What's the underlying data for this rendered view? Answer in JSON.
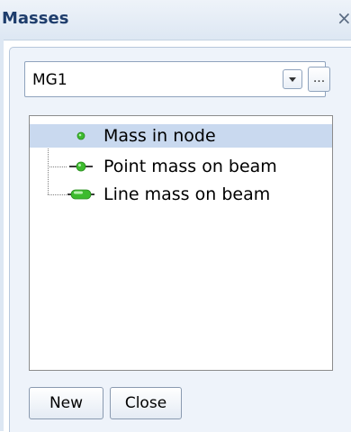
{
  "window": {
    "title": "Masses",
    "close_glyph": "×"
  },
  "combo": {
    "selected_value": "MG1",
    "more_button_label": "..."
  },
  "tree": {
    "items": [
      {
        "label": "Mass in node",
        "icon": "mass-in-node-icon",
        "selected": true
      },
      {
        "label": "Point mass on beam",
        "icon": "point-mass-on-beam-icon",
        "selected": false
      },
      {
        "label": "Line mass on beam",
        "icon": "line-mass-on-beam-icon",
        "selected": false
      }
    ]
  },
  "buttons": {
    "new_label": "New",
    "close_label": "Close"
  },
  "colors": {
    "title_text": "#1e3d6c",
    "selection": "#c9d9ef",
    "icon_green": "#3dbb2e"
  }
}
